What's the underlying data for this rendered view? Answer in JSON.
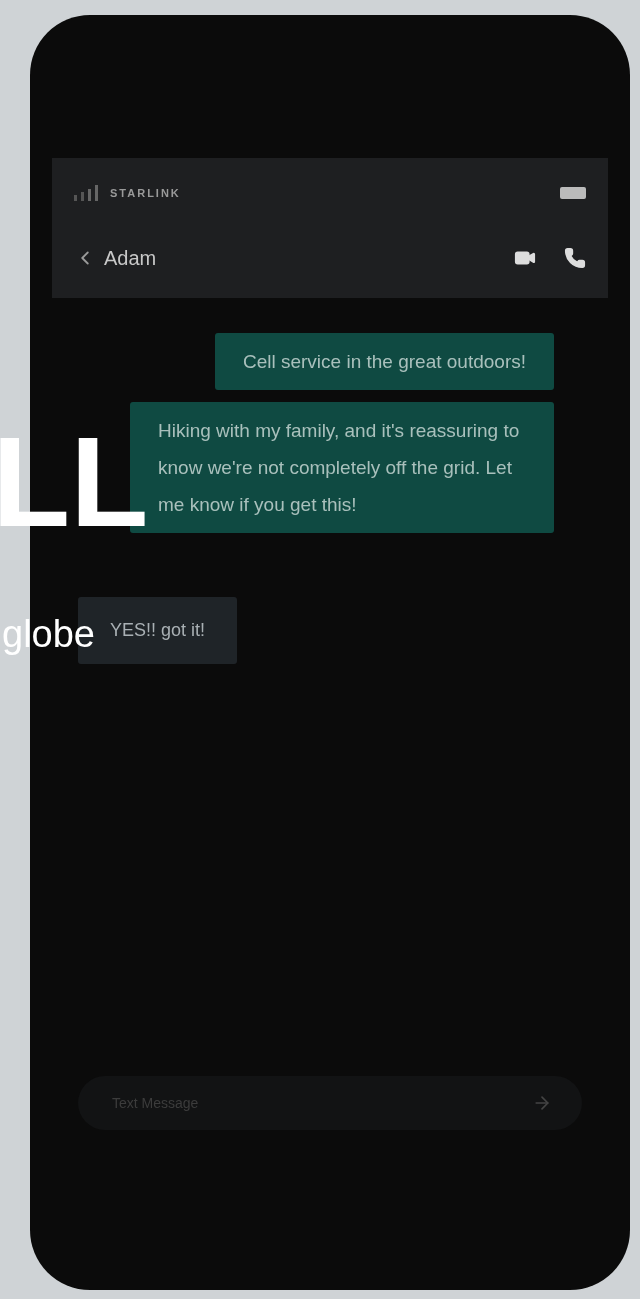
{
  "background_text": [
    "LL",
    "globe"
  ],
  "status_bar": {
    "carrier": "STARLINK"
  },
  "header": {
    "contact": "Adam"
  },
  "messages": [
    {
      "text": "Cell service in the great outdoors!",
      "outgoing": true
    },
    {
      "text": "Hiking with my family, and it's reassuring to know we're not completely off the grid. Let me know if you get this!",
      "outgoing": true
    },
    {
      "text": "YES!! got it!",
      "outgoing": false
    }
  ],
  "composer": {
    "placeholder": "Text Message"
  }
}
